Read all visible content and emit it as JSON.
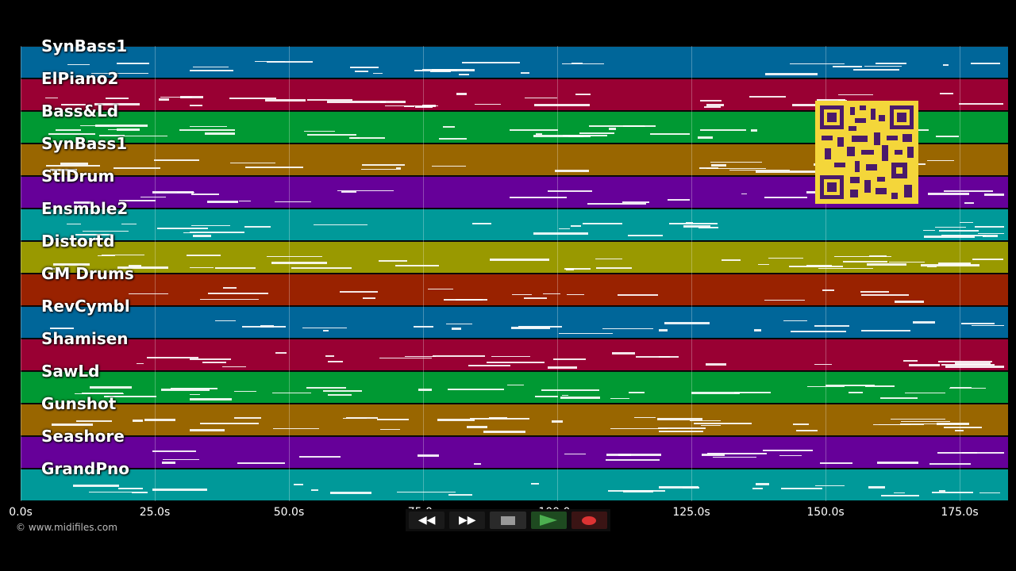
{
  "tracks": [
    {
      "label": "SynBass1",
      "color": "#006699"
    },
    {
      "label": "ElPiano2",
      "color": "#990033"
    },
    {
      "label": "Bass&Ld",
      "color": "#009933"
    },
    {
      "label": "SynBass1",
      "color": "#996600"
    },
    {
      "label": "StlDrum",
      "color": "#660099"
    },
    {
      "label": "Ensmble2",
      "color": "#009999"
    },
    {
      "label": "Distortd",
      "color": "#999900"
    },
    {
      "label": "GM Drums",
      "color": "#992200"
    },
    {
      "label": "RevCymbl",
      "color": "#006699"
    },
    {
      "label": "Shamisen",
      "color": "#990033"
    },
    {
      "label": "SawLd",
      "color": "#009933"
    },
    {
      "label": "Gunshot",
      "color": "#996600"
    },
    {
      "label": "Seashore",
      "color": "#660099"
    },
    {
      "label": "GrandPno",
      "color": "#009999"
    }
  ],
  "timeline": {
    "ticks": [
      "0.0s",
      "25.0s",
      "50.0s",
      "75.0s",
      "100.0s",
      "125.0s",
      "150.0s",
      "175.0s"
    ]
  },
  "copyright": "© www.midifiles.com",
  "transport": {
    "rewind_label": "◀◀",
    "forward_label": "▶▶"
  },
  "qr_color": "#f4d63a"
}
